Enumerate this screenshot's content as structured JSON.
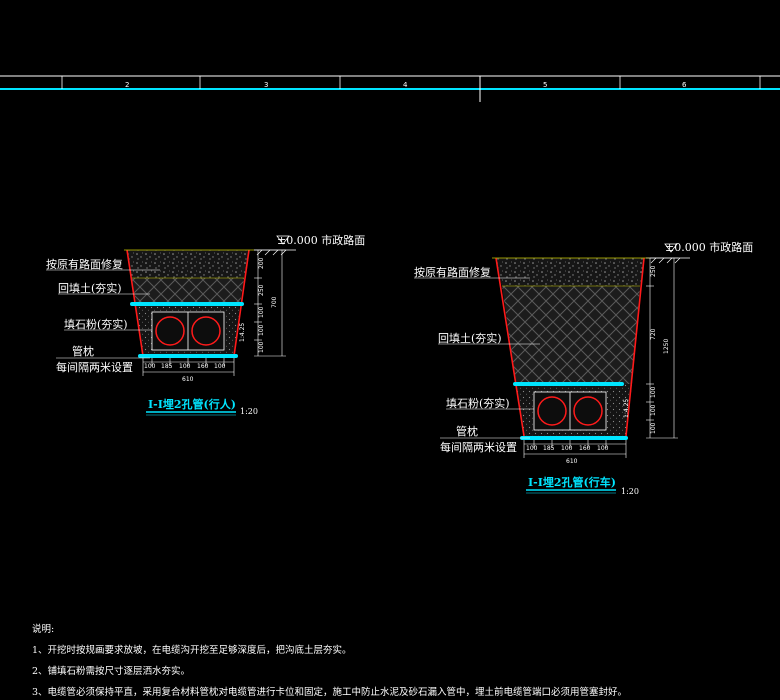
{
  "ruler": {
    "numbers": [
      "2",
      "3",
      "4",
      "5",
      "6"
    ]
  },
  "left": {
    "road_label": "±0.000 市政路面",
    "restore_label": "按原有路面修复",
    "backfill_label": "回填土(夯实)",
    "gravel_label": "填石粉(夯实)",
    "pillow_label": "管枕",
    "pillow_note": "每间隔两米设置",
    "dims_right": [
      "200",
      "250",
      "100",
      "100",
      "100"
    ],
    "total_dim": "700",
    "slope": "1:4.25",
    "dims_bottom": [
      "100",
      "185",
      "100",
      "160",
      "100"
    ],
    "width_dim": "610",
    "title": "I-I埋2孔管(行人)",
    "scale": "1:20"
  },
  "right": {
    "road_label": "±0.000 市政路面",
    "restore_label": "按原有路面修复",
    "backfill_label": "回填土(夯实)",
    "gravel_label": "填石粉(夯实)",
    "pillow_label": "管枕",
    "pillow_note": "每间隔两米设置",
    "dims_right": [
      "250",
      "720",
      "100",
      "100",
      "100"
    ],
    "total_dim": "1250",
    "slope": "1:4.25",
    "dims_bottom": [
      "100",
      "185",
      "100",
      "160",
      "100"
    ],
    "width_dim": "610",
    "title": "I-I埋2孔管(行车)",
    "scale": "1:20"
  },
  "notes": {
    "heading": "说明:",
    "items": [
      "1、开挖时按规画要求放坡，在电缆沟开挖至足够深度后，把沟底土层夯实。",
      "2、铺填石粉需按尺寸逐层洒水夯实。",
      "3、电缆管必须保持平直，采用复合材料管枕对电缆管进行卡位和固定，施工中防止水泥及砂石漏入管中，埋土前电缆管端口必须用管塞封好。"
    ]
  },
  "colors": {
    "cyan": "#00e5ff",
    "red": "#ff1a1a",
    "bg": "#000000",
    "fill": "#3a3a3a"
  }
}
